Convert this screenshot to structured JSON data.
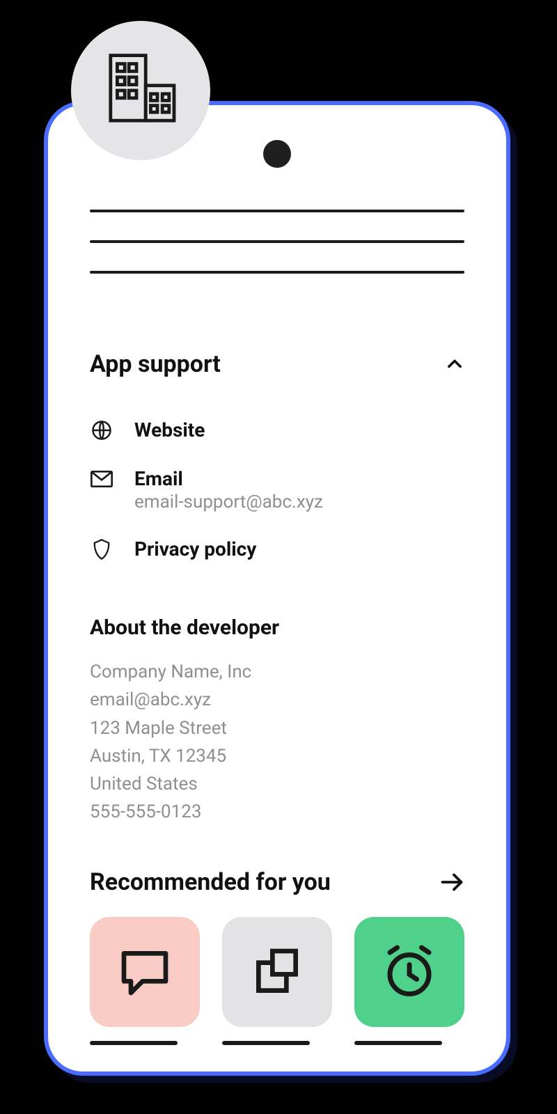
{
  "sections": {
    "app_support": {
      "title": "App support",
      "website": {
        "label": "Website"
      },
      "email": {
        "label": "Email",
        "value": "email-support@abc.xyz"
      },
      "privacy": {
        "label": "Privacy policy"
      }
    },
    "about_developer": {
      "title": "About the developer",
      "company": "Company Name, Inc",
      "email": "email@abc.xyz",
      "street": "123 Maple Street",
      "city_state": "Austin, TX 12345",
      "country": "United States",
      "phone": "555-555-0123"
    },
    "recommended": {
      "title": "Recommended for you",
      "cards": [
        {
          "icon": "chat-icon",
          "bg": "#f9cbc5"
        },
        {
          "icon": "copy-icon",
          "bg": "#e3e3e6"
        },
        {
          "icon": "alarm-icon",
          "bg": "#4fd18b"
        }
      ]
    }
  },
  "colors": {
    "frame_border": "#4a6cff",
    "text_primary": "#111111",
    "text_muted": "#8f8f8f"
  }
}
